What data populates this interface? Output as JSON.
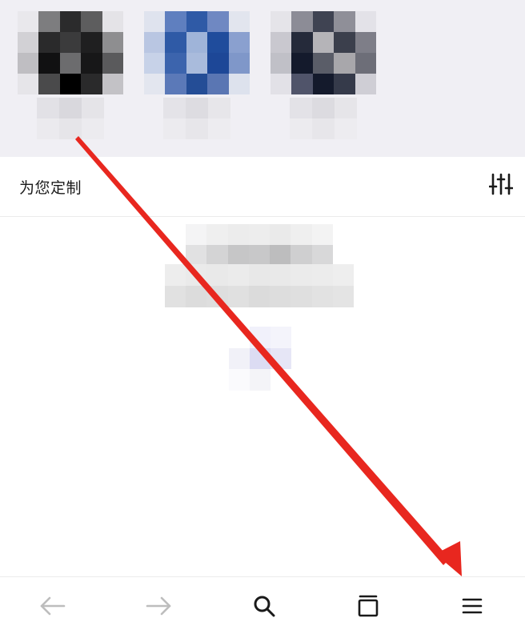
{
  "section": {
    "title": "为您定制",
    "filter_icon": "sliders-icon"
  },
  "shortcuts": [
    {
      "icon": "blurred-app-icon"
    },
    {
      "icon": "blurred-app-icon"
    },
    {
      "icon": "blurred-app-icon"
    }
  ],
  "toolbar": {
    "back_icon": "arrow-left-icon",
    "forward_icon": "arrow-right-icon",
    "search_icon": "search-icon",
    "tabs_icon": "tabs-icon",
    "menu_icon": "menu-icon"
  },
  "colors": {
    "strip_background": "#f0eff4",
    "annotation_arrow": "#e8271f",
    "icon_active": "#1a1a1a",
    "icon_disabled": "#bdbdbd"
  }
}
